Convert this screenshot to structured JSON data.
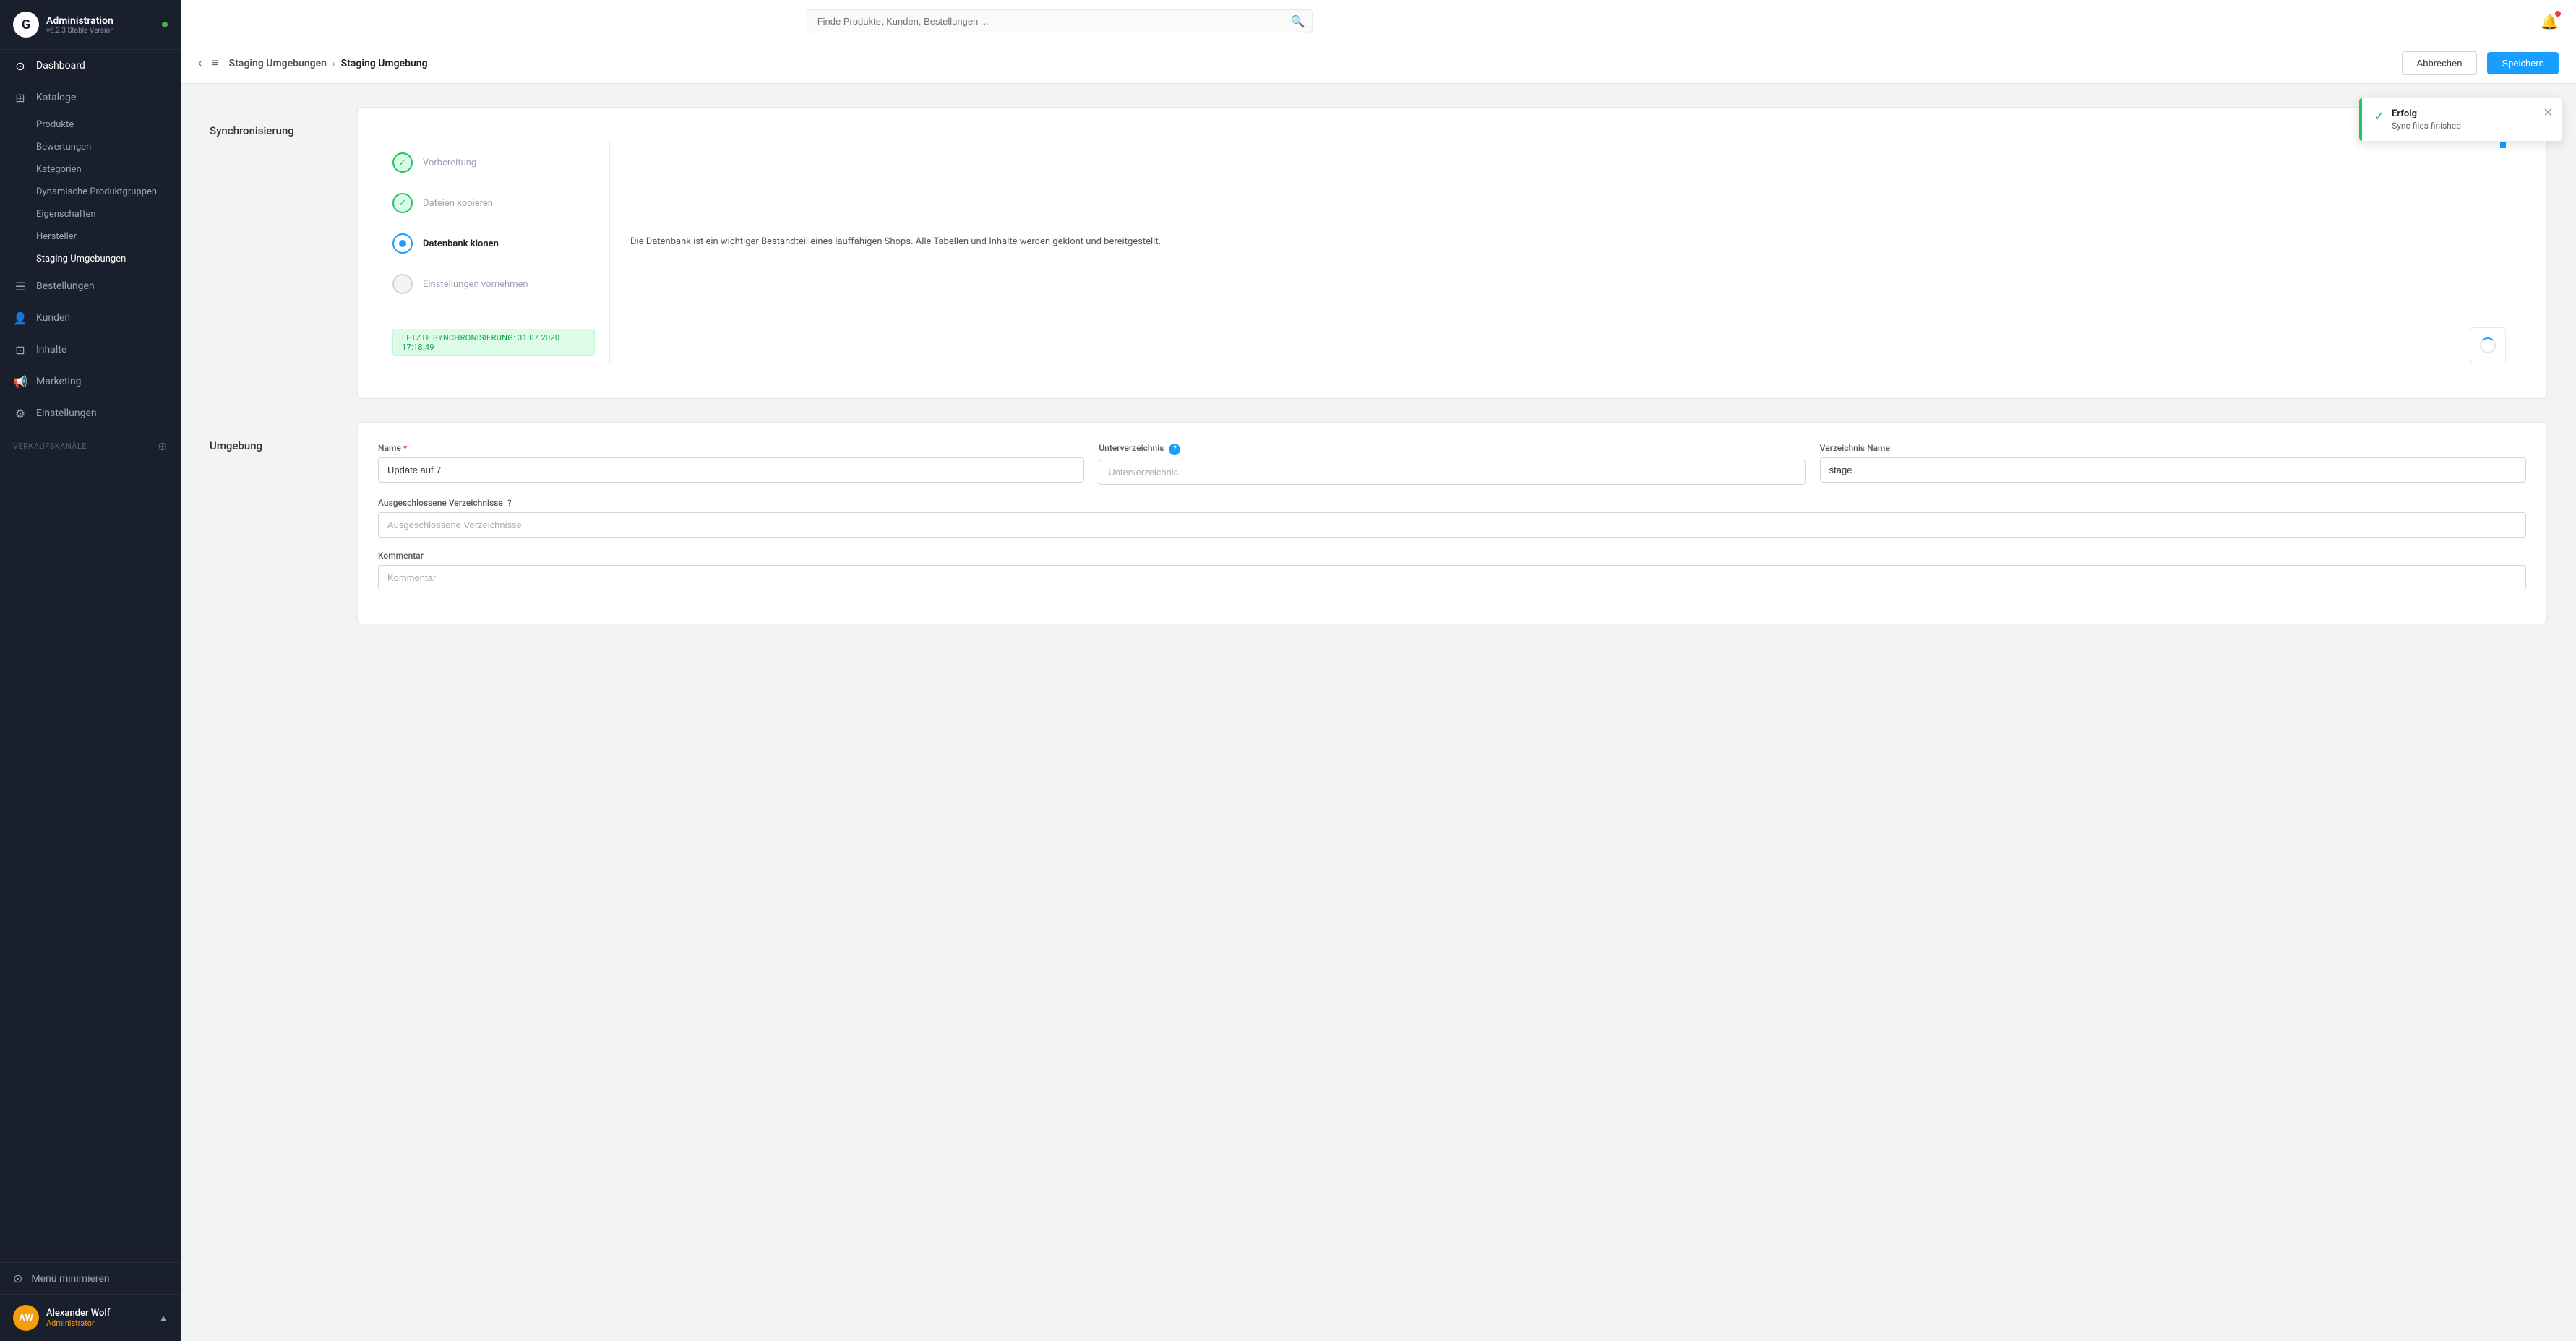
{
  "app": {
    "title": "Administration",
    "version": "v6.2.3 Stable Version",
    "online": true
  },
  "search": {
    "placeholder": "Finde Produkte, Kunden, Bestellungen ..."
  },
  "sidebar": {
    "nav_items": [
      {
        "id": "dashboard",
        "label": "Dashboard",
        "icon": "⊙",
        "active": false
      },
      {
        "id": "kataloge",
        "label": "Kataloge",
        "icon": "⊞",
        "active": true
      }
    ],
    "kataloge_sub": [
      {
        "id": "produkte",
        "label": "Produkte",
        "active": false
      },
      {
        "id": "bewertungen",
        "label": "Bewertungen",
        "active": false
      },
      {
        "id": "kategorien",
        "label": "Kategorien",
        "active": false
      },
      {
        "id": "dynamische-produktgruppen",
        "label": "Dynamische Produktgruppen",
        "active": false
      },
      {
        "id": "eigenschaften",
        "label": "Eigenschaften",
        "active": false
      },
      {
        "id": "hersteller",
        "label": "Hersteller",
        "active": false
      },
      {
        "id": "staging-umgebungen",
        "label": "Staging Umgebungen",
        "active": true
      }
    ],
    "nav_items2": [
      {
        "id": "bestellungen",
        "label": "Bestellungen",
        "icon": "☰",
        "active": false
      },
      {
        "id": "kunden",
        "label": "Kunden",
        "icon": "👤",
        "active": false
      },
      {
        "id": "inhalte",
        "label": "Inhalte",
        "icon": "⊡",
        "active": false
      },
      {
        "id": "marketing",
        "label": "Marketing",
        "icon": "📢",
        "active": false
      },
      {
        "id": "einstellungen",
        "label": "Einstellungen",
        "icon": "⚙",
        "active": false
      }
    ],
    "verkaufskanaele_label": "Verkaufskanäle",
    "minimize_label": "Menü minimieren",
    "user": {
      "initials": "AW",
      "name": "Alexander Wolf",
      "role": "Administrator"
    }
  },
  "header": {
    "back_icon": "‹",
    "list_icon": "≡",
    "breadcrumb_parent": "Staging Umgebungen",
    "breadcrumb_sep": "›",
    "breadcrumb_current": "Staging Umgebung",
    "cancel_label": "Abbrechen",
    "save_label": "Speichern"
  },
  "notification": {
    "title": "Erfolg",
    "message": "Sync files finished"
  },
  "sync_section": {
    "label": "Synchronisierung",
    "steps": [
      {
        "id": "vorbereitung",
        "label": "Vorbereitung",
        "state": "done"
      },
      {
        "id": "dateien-kopieren",
        "label": "Dateien kopieren",
        "state": "done"
      },
      {
        "id": "datenbank-klonen",
        "label": "Datenbank klonen",
        "state": "active"
      },
      {
        "id": "einstellungen-vornehmen",
        "label": "Einstellungen vornehmen",
        "state": "pending"
      }
    ],
    "info_text": "Die Datenbank ist ein wichtiger Bestandteil eines lauffähigen Shops. Alle Tabellen und Inhalte werden geklont und bereitgestellt.",
    "last_sync_label": "LETZTE SYNCHRONISIERUNG:",
    "last_sync_value": "31.07.2020 17:18:49"
  },
  "umgebung_section": {
    "label": "Umgebung",
    "fields": {
      "name_label": "Name",
      "name_required": true,
      "name_value": "Update auf 7",
      "unterverzeichnis_label": "Unterverzeichnis",
      "unterverzeichnis_placeholder": "Unterverzeichnis",
      "unterverzeichnis_value": "",
      "verzeichnis_name_label": "Verzeichnis Name",
      "verzeichnis_name_value": "stage",
      "ausgeschlossene_label": "Ausgeschlossene Verzeichnisse",
      "ausgeschlossene_placeholder": "Ausgeschlossene Verzeichnisse",
      "kommentar_label": "Kommentar",
      "kommentar_placeholder": "Kommentar"
    }
  }
}
